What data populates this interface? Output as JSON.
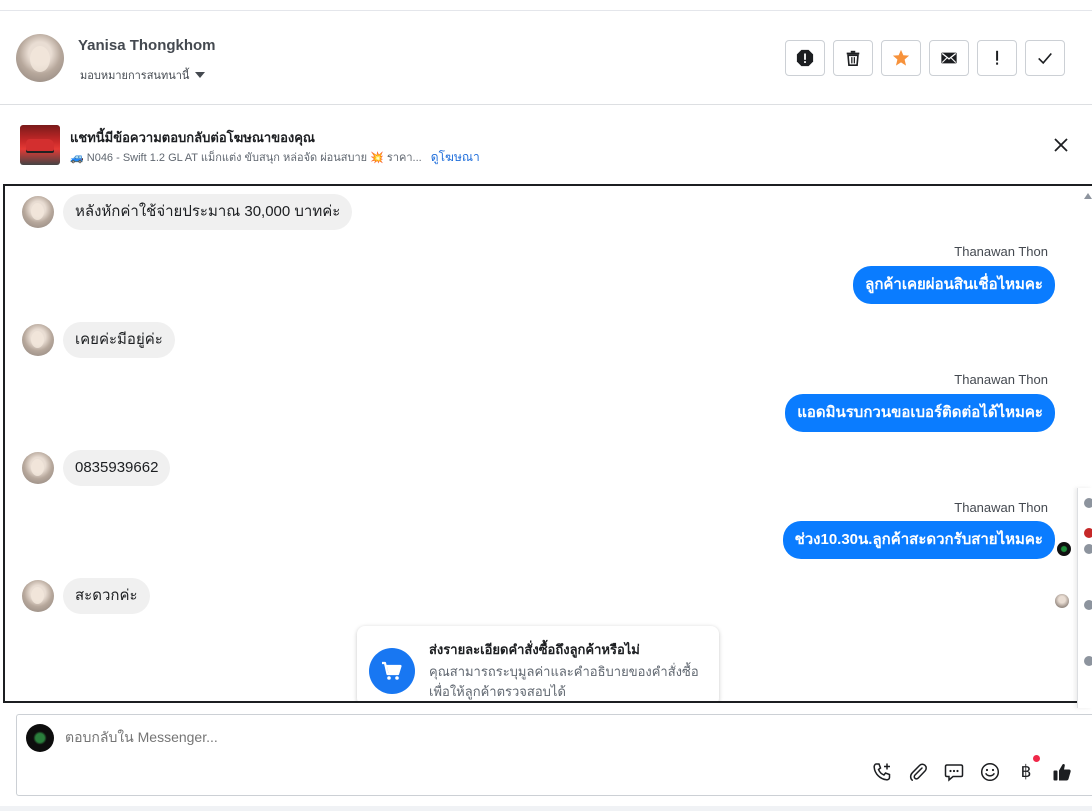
{
  "header": {
    "user_name": "Yanisa Thongkhom",
    "assign_label": "มอบหมายการสนทนานี้",
    "actions": [
      {
        "name": "spam-icon"
      },
      {
        "name": "trash-icon"
      },
      {
        "name": "star-icon",
        "color": "#f7923b"
      },
      {
        "name": "envelope-icon"
      },
      {
        "name": "exclamation-icon"
      },
      {
        "name": "check-icon"
      }
    ]
  },
  "ad_banner": {
    "title": "แชทนี้มีข้อความตอบกลับต่อโฆษณาของคุณ",
    "description": "🚙 N046 - Swift 1.2 GL AT แม็กแต่ง ขับสนุก หล่อจัด ผ่อนสบาย 💥 ราคา...",
    "link_label": "ดูโฆษณา"
  },
  "messages": [
    {
      "direction": "in",
      "text": "หลังหักค่าใช้จ่ายประมาณ 30,000 บาทค่ะ"
    },
    {
      "direction": "out",
      "sender": "Thanawan Thon",
      "text": "ลูกค้าเคยผ่อนสินเชื่อไหมคะ"
    },
    {
      "direction": "in",
      "text": "เคยค่ะมีอยู่ค่ะ"
    },
    {
      "direction": "out",
      "sender": "Thanawan Thon",
      "text": "แอดมินรบกวนขอเบอร์ติดต่อได้ไหมคะ"
    },
    {
      "direction": "in",
      "text": "0835939662"
    },
    {
      "direction": "out",
      "sender": "Thanawan Thon",
      "text": "ช่วง10.30น.ลูกค้าสะดวกรับสายไหมคะ"
    },
    {
      "direction": "in",
      "text": "สะดวกค่ะ"
    }
  ],
  "order_card": {
    "title": "ส่งรายละเอียดคำสั่งซื้อถึงลูกค้าหรือไม่",
    "description": "คุณสามารถระบุมูลค่าและคำอธิบายของคำสั่งซื้อ เพื่อให้ลูกค้าตรวจสอบได้"
  },
  "composer": {
    "placeholder": "ตอบกลับใน Messenger...",
    "baht_symbol": "฿",
    "tools": [
      "phone-plus-icon",
      "paperclip-icon",
      "saved-reply-icon",
      "emoji-icon",
      "baht-icon",
      "thumbs-up-icon"
    ]
  },
  "colors": {
    "outgoing_bubble": "#0a7cff",
    "incoming_bubble": "#f0f0f0",
    "link": "#216fdb",
    "notification": "#f02849"
  }
}
